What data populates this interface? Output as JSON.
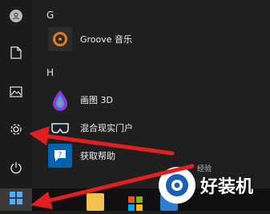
{
  "rail": {
    "items": [
      {
        "name": "user-avatar",
        "icon": "person-icon"
      },
      {
        "name": "documents",
        "icon": "document-icon"
      },
      {
        "name": "pictures",
        "icon": "image-icon"
      },
      {
        "name": "settings",
        "icon": "gear-icon"
      },
      {
        "name": "power",
        "icon": "power-icon"
      }
    ]
  },
  "apps": {
    "groups": [
      {
        "letter": "G",
        "items": [
          {
            "label": "Groove 音乐",
            "icon": "groove-music-icon",
            "color": "#2b2b2b"
          }
        ]
      },
      {
        "letter": "H",
        "items": [
          {
            "label": "画图 3D",
            "icon": "paint3d-icon",
            "color": "#1e1e1e"
          },
          {
            "label": "混合现实门户",
            "icon": "mixed-reality-icon",
            "color": "#1e1e1e"
          },
          {
            "label": "获取帮助",
            "icon": "get-help-icon",
            "color": "#0063b1"
          }
        ]
      }
    ]
  },
  "taskbar": {
    "start_icon": "windows-logo-icon",
    "items": [
      "file-explorer-icon",
      "store-icon",
      "edge-icon"
    ]
  },
  "watermark": {
    "text": "好装机",
    "sub": "经验"
  },
  "colors": {
    "arrow": "#e02020",
    "accent": "#0078d7"
  }
}
